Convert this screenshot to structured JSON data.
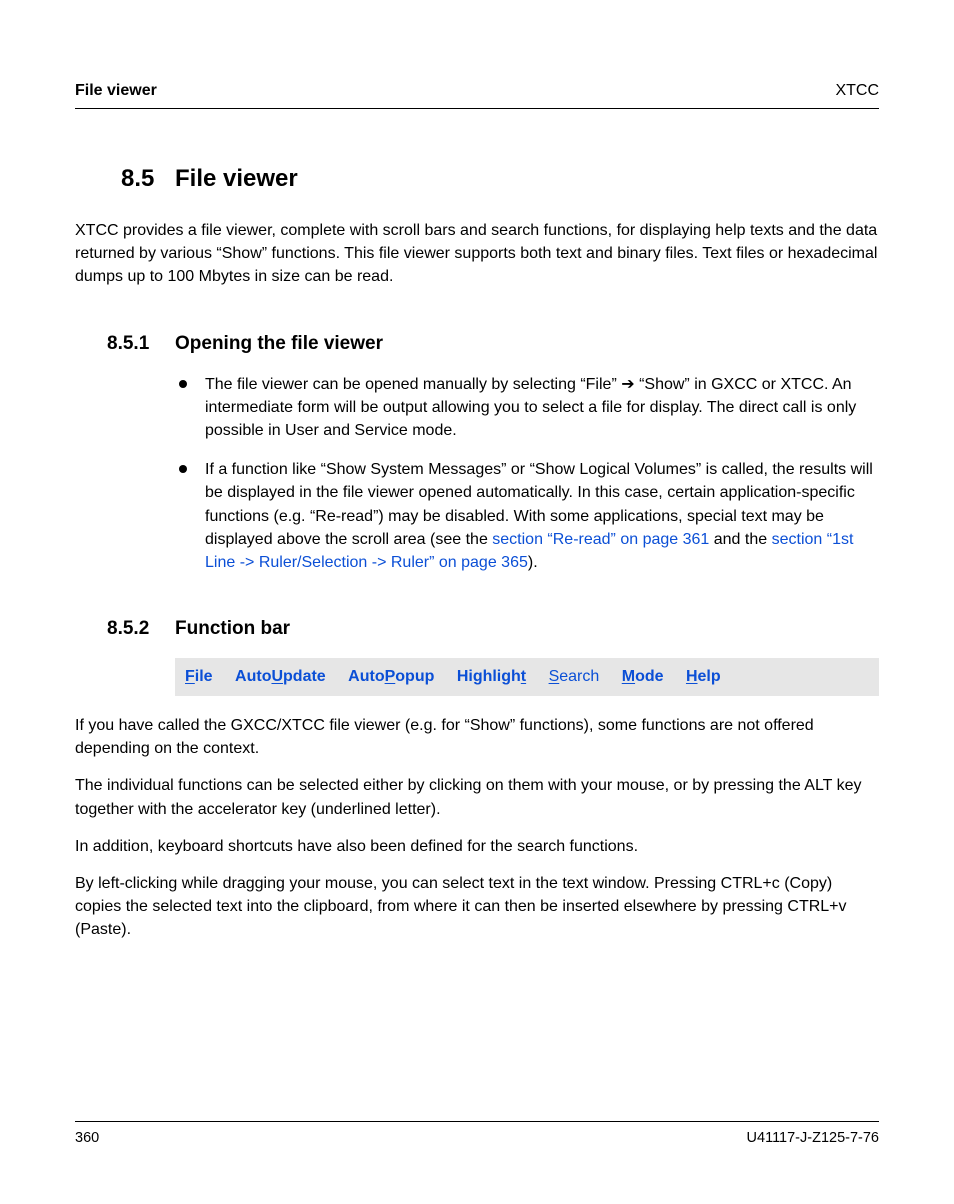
{
  "header": {
    "left": "File viewer",
    "right": "XTCC"
  },
  "section": {
    "num": "8.5",
    "title": "File viewer",
    "intro": "XTCC provides a file viewer, complete with scroll bars and search functions, for displaying help texts and the data returned by various “Show” functions. This file viewer supports both text and binary files. Text files or hexadecimal dumps up to 100 Mbytes in size can be read."
  },
  "sub1": {
    "num": "8.5.1",
    "title": "Opening the file viewer",
    "bullets": [
      {
        "pre": "The file viewer can be opened manually by selecting “File” ",
        "arrow": "➔",
        "post": " “Show” in GXCC or XTCC. An intermediate form will be output allowing you to select a file for display. The direct call is only possible in User and Service mode."
      },
      {
        "pre": "If a function like “Show System Messages” or “Show Logical Volumes” is called, the results will be displayed in the file viewer opened automatically. In this case, certain application-specific functions (e.g. “Re-read”) may be disabled. With some applications, special text may be displayed above the scroll area (see the ",
        "link1": "section “Re-read” on page 361",
        "mid": " and the ",
        "link2": "section “1st Line -> Ruler/Selection -> Ruler” on page 365",
        "post2": ")."
      }
    ]
  },
  "sub2": {
    "num": "8.5.2",
    "title": "Function bar",
    "fnbar": {
      "file": {
        "u": "F",
        "rest": "ile"
      },
      "autoupdate": {
        "pre": "Auto",
        "u": "U",
        "rest": "pdate"
      },
      "autopopup": {
        "pre": "Auto",
        "u": "P",
        "rest": "opup"
      },
      "highlight": {
        "pre": "Highligh",
        "u": "t",
        "rest": ""
      },
      "search": {
        "u": "S",
        "rest": "earch"
      },
      "mode": {
        "u": "M",
        "rest": "ode"
      },
      "help": {
        "u": "H",
        "rest": "elp"
      }
    },
    "paras": [
      "If you have called the GXCC/XTCC file viewer (e.g. for “Show” functions), some functions are not offered depending on the context.",
      "The individual functions can be selected either by clicking on them with your mouse, or by pressing the ALT key together with the accelerator key (underlined letter).",
      "In addition, keyboard shortcuts have also been defined for the search functions.",
      "By left-clicking while dragging your mouse, you can select text in the text window. Pressing CTRL+c (Copy) copies the selected text into the clipboard, from where it can then be inserted elsewhere by pressing CTRL+v (Paste)."
    ]
  },
  "footer": {
    "page": "360",
    "docid": "U41117-J-Z125-7-76"
  }
}
